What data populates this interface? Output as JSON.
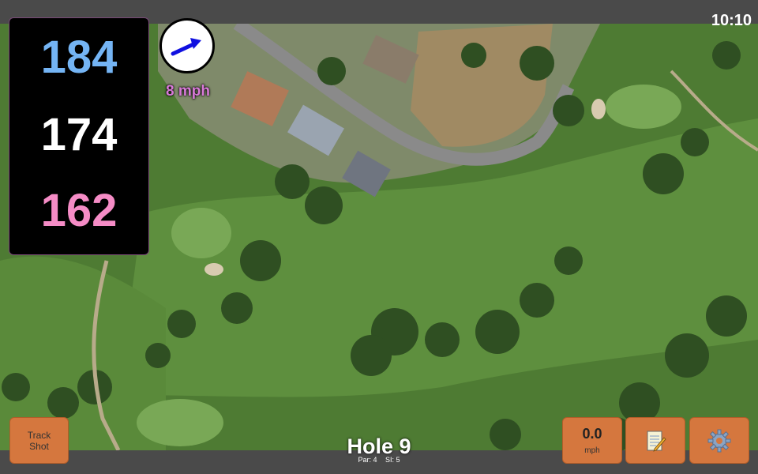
{
  "status": {
    "time": "10:10"
  },
  "distances": {
    "back": "184",
    "middle": "174",
    "front": "162"
  },
  "wind": {
    "speed_label": "8 mph",
    "direction_icon": "wind-arrow-icon"
  },
  "buttons": {
    "track_shot_line1": "Track",
    "track_shot_line2": "Shot",
    "speed_value": "0.0",
    "speed_unit": "mph",
    "notes_icon": "notepad-icon",
    "settings_icon": "gear-icon"
  },
  "hole": {
    "title": "Hole 9",
    "par": "Par: 4",
    "si": "SI: 5"
  },
  "colors": {
    "back_distance": "#74b4f4",
    "middle_distance": "#ffffff",
    "front_distance": "#f58cc6",
    "wind_label": "#d879d8",
    "button_orange": "#d5773e"
  }
}
